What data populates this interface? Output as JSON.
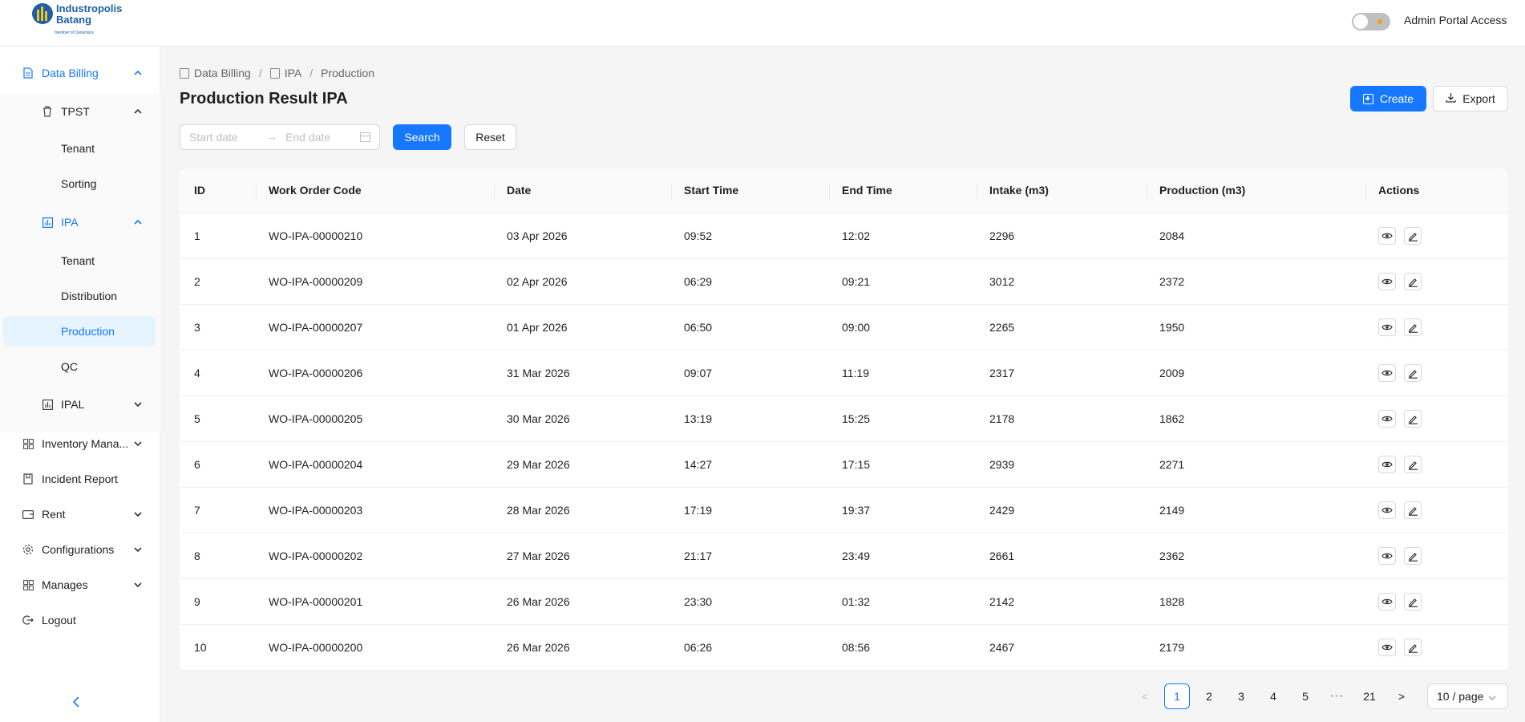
{
  "header": {
    "logo_line1": "Industropolis",
    "logo_line2": "Batang",
    "logo_sub": "member of Danantara",
    "admin_toggle_label": "Admin Portal Access"
  },
  "sidebar": {
    "data_billing": "Data Billing",
    "tpst": "TPST",
    "tpst_tenant": "Tenant",
    "tpst_sorting": "Sorting",
    "ipa": "IPA",
    "ipa_tenant": "Tenant",
    "ipa_distribution": "Distribution",
    "ipa_production": "Production",
    "ipa_qc": "QC",
    "ipal": "IPAL",
    "inventory": "Inventory Mana...",
    "incident": "Incident Report",
    "rent": "Rent",
    "configurations": "Configurations",
    "manages": "Manages",
    "logout": "Logout",
    "collapse": "<"
  },
  "breadcrumb": {
    "item1": "Data Billing",
    "item2": "IPA",
    "item3": "Production",
    "sep": "/"
  },
  "page": {
    "title": "Production Result IPA",
    "create_label": "Create",
    "export_label": "Export"
  },
  "filters": {
    "start_placeholder": "Start date",
    "end_placeholder": "End date",
    "arrow": "→",
    "search_label": "Search",
    "reset_label": "Reset"
  },
  "table": {
    "columns": [
      "ID",
      "Work Order Code",
      "Date",
      "Start Time",
      "End Time",
      "Intake (m3)",
      "Production (m3)",
      "Actions"
    ],
    "rows": [
      [
        "1",
        "WO-IPA-00000210",
        "03 Apr 2026",
        "09:52",
        "12:02",
        "2296",
        "2084"
      ],
      [
        "2",
        "WO-IPA-00000209",
        "02 Apr 2026",
        "06:29",
        "09:21",
        "3012",
        "2372"
      ],
      [
        "3",
        "WO-IPA-00000207",
        "01 Apr 2026",
        "06:50",
        "09:00",
        "2265",
        "1950"
      ],
      [
        "4",
        "WO-IPA-00000206",
        "31 Mar 2026",
        "09:07",
        "11:19",
        "2317",
        "2009"
      ],
      [
        "5",
        "WO-IPA-00000205",
        "30 Mar 2026",
        "13:19",
        "15:25",
        "2178",
        "1862"
      ],
      [
        "6",
        "WO-IPA-00000204",
        "29 Mar 2026",
        "14:27",
        "17:15",
        "2939",
        "2271"
      ],
      [
        "7",
        "WO-IPA-00000203",
        "28 Mar 2026",
        "17:19",
        "19:37",
        "2429",
        "2149"
      ],
      [
        "8",
        "WO-IPA-00000202",
        "27 Mar 2026",
        "21:17",
        "23:49",
        "2661",
        "2362"
      ],
      [
        "9",
        "WO-IPA-00000201",
        "26 Mar 2026",
        "23:30",
        "01:32",
        "2142",
        "1828"
      ],
      [
        "10",
        "WO-IPA-00000200",
        "26 Mar 2026",
        "06:26",
        "08:56",
        "2467",
        "2179"
      ]
    ]
  },
  "pagination": {
    "prev": "<",
    "pages": [
      "1",
      "2",
      "3",
      "4",
      "5"
    ],
    "ellipsis": "•••",
    "last": "21",
    "next": ">",
    "current": "1",
    "page_size": "10 / page"
  },
  "colors": {
    "primary": "#1677ff",
    "active_bg": "#e6f4ff"
  }
}
